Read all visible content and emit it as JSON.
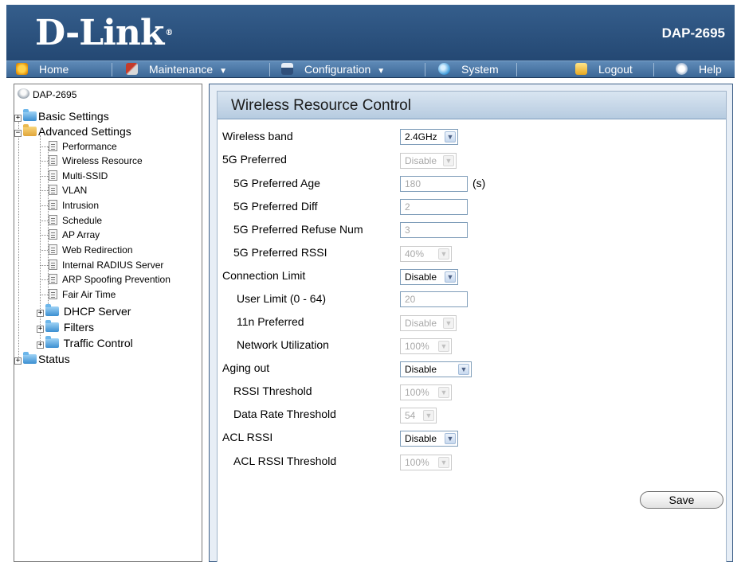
{
  "header": {
    "brand": "D-Link",
    "model": "DAP-2695"
  },
  "menu": {
    "home": "Home",
    "maintenance": "Maintenance",
    "configuration": "Configuration",
    "system": "System",
    "logout": "Logout",
    "help": "Help"
  },
  "tree": {
    "root": "DAP-2695",
    "basic_settings": "Basic Settings",
    "advanced_settings": "Advanced Settings",
    "advanced_items": [
      "Performance",
      "Wireless Resource",
      "Multi-SSID",
      "VLAN",
      "Intrusion",
      "Schedule",
      "AP Array",
      "Web Redirection",
      "Internal RADIUS Server",
      "ARP Spoofing Prevention",
      "Fair Air Time"
    ],
    "dhcp_server": "DHCP Server",
    "filters": "Filters",
    "traffic_control": "Traffic Control",
    "status": "Status"
  },
  "panel": {
    "title": "Wireless Resource Control",
    "wireless_band": {
      "label": "Wireless band",
      "value": "2.4GHz"
    },
    "pref_5g": {
      "label": "5G Preferred",
      "value": "Disable"
    },
    "pref_5g_age": {
      "label": "5G Preferred Age",
      "value": "180",
      "unit": "(s)"
    },
    "pref_5g_diff": {
      "label": "5G Preferred Diff",
      "value": "2"
    },
    "pref_5g_refuse": {
      "label": "5G Preferred Refuse Num",
      "value": "3"
    },
    "pref_5g_rssi": {
      "label": "5G Preferred RSSI",
      "value": "40%"
    },
    "conn_limit": {
      "label": "Connection Limit",
      "value": "Disable"
    },
    "user_limit": {
      "label": "User Limit (0 - 64)",
      "value": "20"
    },
    "n_pref": {
      "label": "11n Preferred",
      "value": "Disable"
    },
    "net_util": {
      "label": "Network Utilization",
      "value": "100%"
    },
    "aging_out": {
      "label": "Aging out",
      "value": "Disable"
    },
    "rssi_threshold": {
      "label": "RSSI Threshold",
      "value": "100%"
    },
    "data_rate_threshold": {
      "label": "Data Rate Threshold",
      "value": "54"
    },
    "acl_rssi": {
      "label": "ACL RSSI",
      "value": "Disable"
    },
    "acl_rssi_threshold": {
      "label": "ACL RSSI Threshold",
      "value": "100%"
    },
    "save": "Save"
  }
}
